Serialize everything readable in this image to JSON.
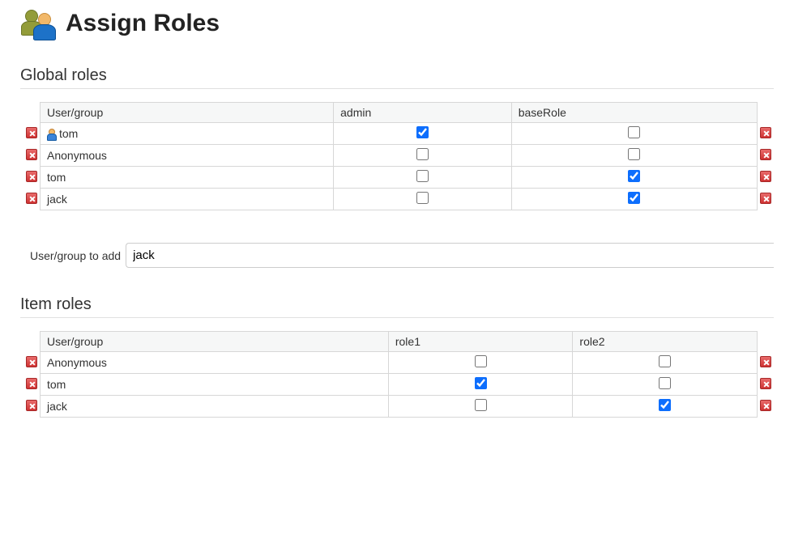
{
  "page": {
    "title": "Assign Roles"
  },
  "sections": {
    "global": {
      "heading": "Global roles",
      "columns": {
        "c0": "User/group",
        "c1": "admin",
        "c2": "baseRole"
      },
      "rows": [
        {
          "name": "tom",
          "admin": true,
          "baseRole": false,
          "hasUserIcon": true
        },
        {
          "name": "Anonymous",
          "admin": false,
          "baseRole": false,
          "hasUserIcon": false
        },
        {
          "name": "tom",
          "admin": false,
          "baseRole": true,
          "hasUserIcon": false
        },
        {
          "name": "jack",
          "admin": false,
          "baseRole": true,
          "hasUserIcon": false
        }
      ],
      "add": {
        "label": "User/group to add",
        "value": "jack"
      }
    },
    "item": {
      "heading": "Item roles",
      "columns": {
        "c0": "User/group",
        "c1": "role1",
        "c2": "role2"
      },
      "rows": [
        {
          "name": "Anonymous",
          "role1": false,
          "role2": false
        },
        {
          "name": "tom",
          "role1": true,
          "role2": false
        },
        {
          "name": "jack",
          "role1": false,
          "role2": true
        }
      ]
    }
  }
}
